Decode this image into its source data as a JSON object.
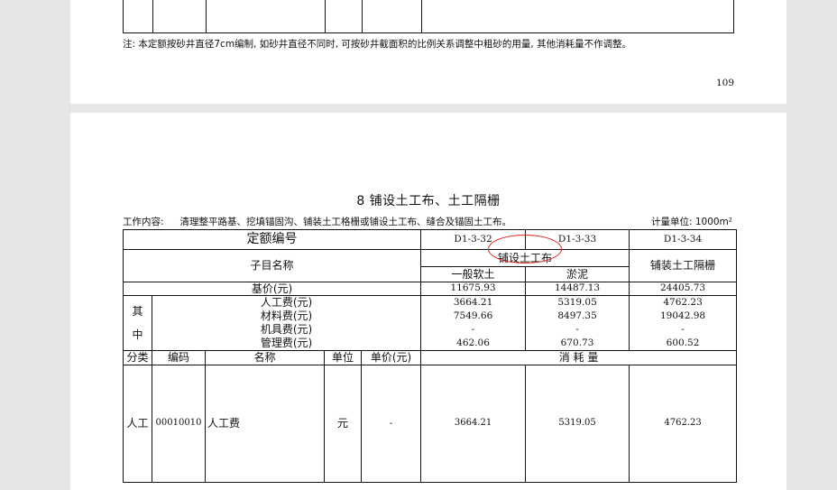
{
  "page1": {
    "note": "注:  本定额按砂井直径7cm编制, 如砂井直径不同时, 可按砂井截面积的比例关系调整中粗砂的用量, 其他消耗量不作调整。",
    "page_number": "109"
  },
  "page2": {
    "section_title": "8 铺设土工布、土工隔栅",
    "work_content_label": "工作内容:",
    "work_content_text": "清理整平路基、挖填锚固沟、铺装土工格栅或铺设土工布、缝合及锚固土工布。",
    "unit_label": "计量单位: 1000m²",
    "table": {
      "quota_number_label": "定额编号",
      "item_name_label": "子目名称",
      "codes": [
        "D1-3-32",
        "D1-3-33",
        "D1-3-34"
      ],
      "group_label": "铺设土工布",
      "sub_names": [
        "一般软土",
        "淤泥"
      ],
      "third_name": "铺装土工隔栅",
      "base_price_label": "基价(元)",
      "base_prices": [
        "11675.93",
        "14487.13",
        "24405.73"
      ],
      "qizhong_1": "其",
      "qizhong_2": "中",
      "fee_rows": [
        {
          "label": "人工费(元)",
          "values": [
            "3664.21",
            "5319.05",
            "4762.23"
          ]
        },
        {
          "label": "材料费(元)",
          "values": [
            "7549.66",
            "8497.35",
            "19042.98"
          ]
        },
        {
          "label": "机具费(元)",
          "values": [
            "-",
            "-",
            "-"
          ]
        },
        {
          "label": "管理费(元)",
          "values": [
            "462.06",
            "670.73",
            "600.52"
          ]
        }
      ],
      "headers": {
        "category": "分类",
        "code": "编码",
        "name": "名称",
        "unit": "单位",
        "unit_price": "单价(元)",
        "consumption": "消 耗 量"
      },
      "rows": [
        {
          "category": "人工",
          "code": "00010010",
          "name": "人工费",
          "unit": "元",
          "unit_price": "-",
          "values": [
            "3664.21",
            "5319.05",
            "4762.23"
          ]
        }
      ]
    }
  },
  "colors": {
    "page_bg": "#e6e6e6",
    "paper": "#ffffff",
    "annotation_circle": "#dd2222"
  }
}
